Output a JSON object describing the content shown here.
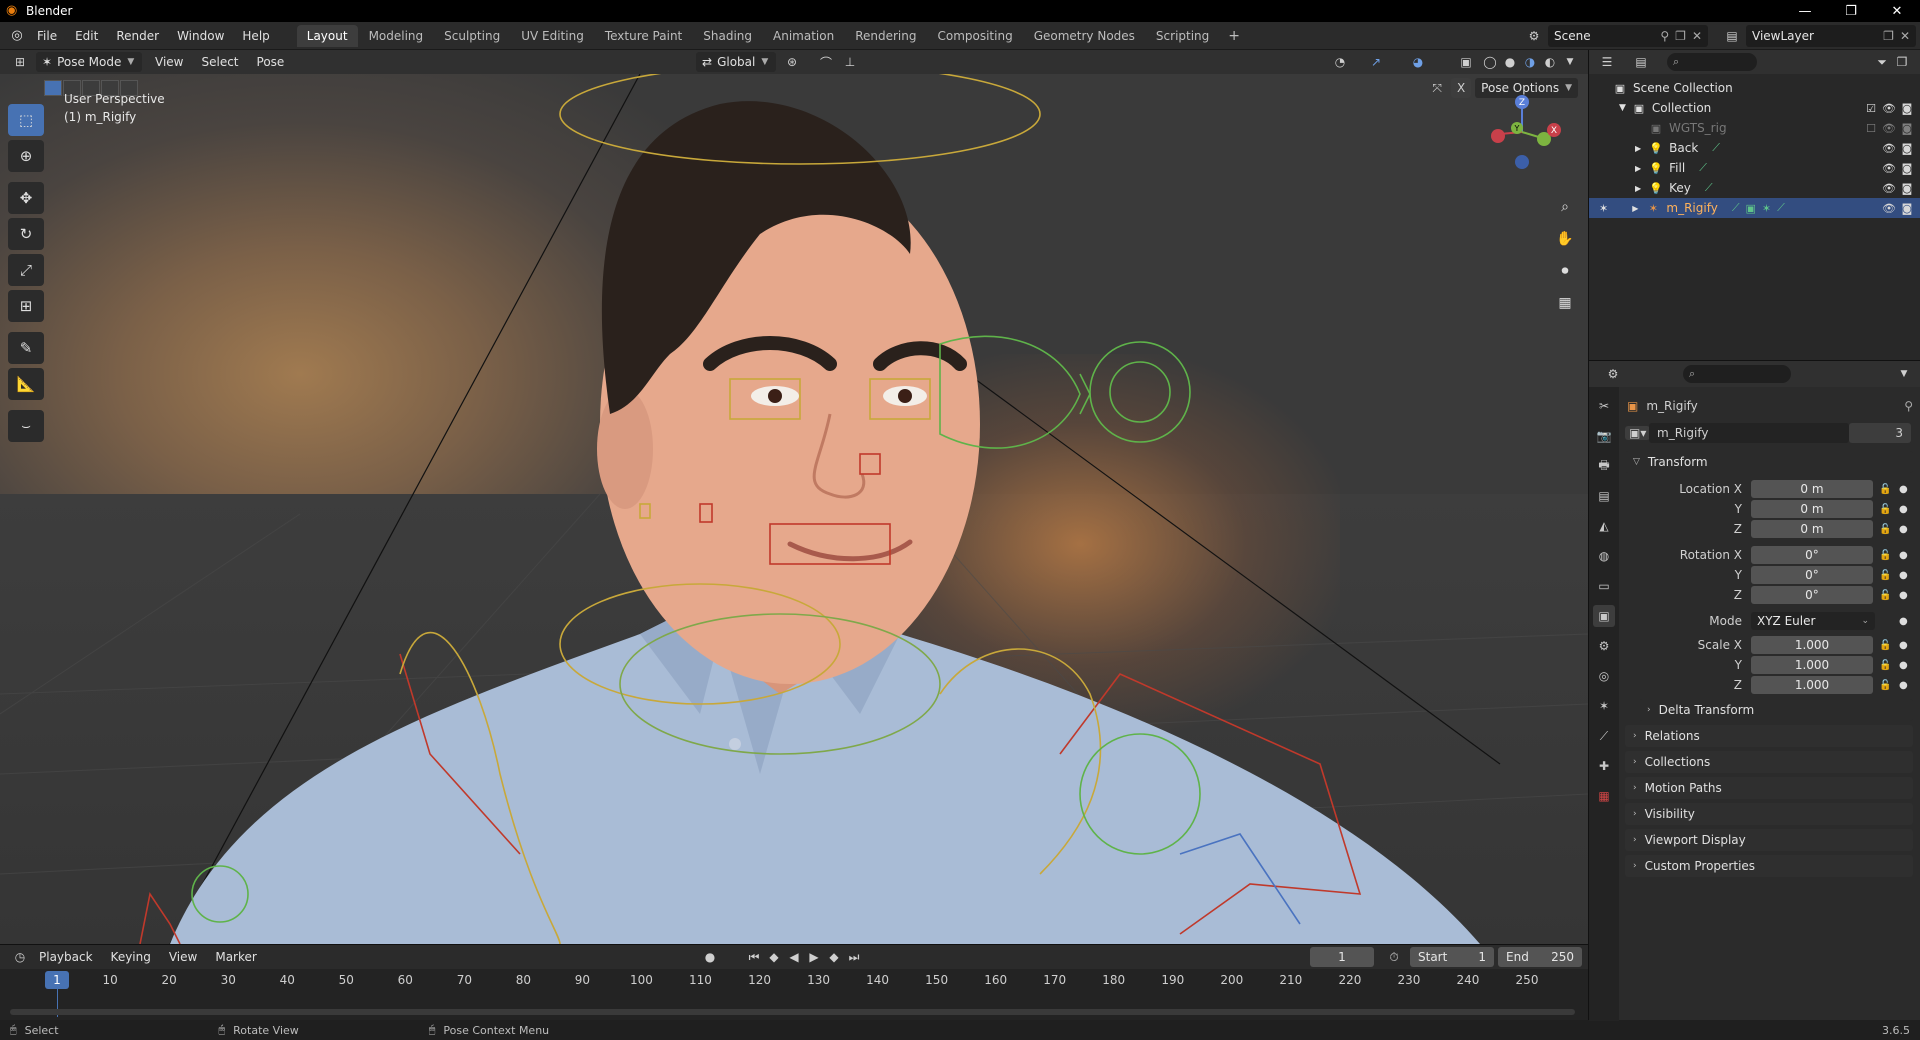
{
  "window": {
    "title": "Blender",
    "buttons": [
      "—",
      "❐",
      "✕"
    ]
  },
  "menu": [
    "File",
    "Edit",
    "Render",
    "Window",
    "Help"
  ],
  "workspaces": {
    "active": "Layout",
    "tabs": [
      "Layout",
      "Modeling",
      "Sculpting",
      "UV Editing",
      "Texture Paint",
      "Shading",
      "Animation",
      "Rendering",
      "Compositing",
      "Geometry Nodes",
      "Scripting"
    ]
  },
  "scene": {
    "name": "Scene",
    "view_layer": "ViewLayer"
  },
  "viewport_header": {
    "mode": "Pose Mode",
    "menus": [
      "View",
      "Select",
      "Pose"
    ],
    "orientation": "Global",
    "pose_options": "Pose Options"
  },
  "viewport": {
    "perspective": "User Perspective",
    "active_object": "(1) m_Rigify",
    "gizmo": {
      "z": "Z",
      "y": "Y",
      "x": "X"
    }
  },
  "outliner": {
    "root": "Scene Collection",
    "collection": "Collection",
    "items": [
      {
        "name": "WGTS_rig",
        "dim": true
      },
      {
        "name": "Back"
      },
      {
        "name": "Fill"
      },
      {
        "name": "Key"
      },
      {
        "name": "m_Rigify",
        "selected": true
      }
    ]
  },
  "properties": {
    "object_name": "m_Rigify",
    "data_name": "m_Rigify",
    "users": "3",
    "transform": {
      "header": "Transform",
      "location": {
        "label": "Location X",
        "x": "0 m",
        "y": "0 m",
        "z": "0 m"
      },
      "rotation": {
        "label": "Rotation X",
        "x": "0°",
        "y": "0°",
        "z": "0°"
      },
      "mode_label": "Mode",
      "mode": "XYZ Euler",
      "scale": {
        "label": "Scale X",
        "x": "1.000",
        "y": "1.000",
        "z": "1.000"
      },
      "axis_y": "Y",
      "axis_z": "Z"
    },
    "subpanels": [
      "Delta Transform"
    ],
    "panels": [
      "Relations",
      "Collections",
      "Motion Paths",
      "Visibility",
      "Viewport Display",
      "Custom Properties"
    ]
  },
  "timeline": {
    "menus": [
      "Playback",
      "Keying",
      "View",
      "Marker"
    ],
    "current_frame": "1",
    "start_label": "Start",
    "start": "1",
    "end_label": "End",
    "end": "250",
    "ruler": [
      "1",
      "10",
      "20",
      "30",
      "40",
      "50",
      "60",
      "70",
      "80",
      "90",
      "100",
      "110",
      "120",
      "130",
      "140",
      "150",
      "160",
      "170",
      "180",
      "190",
      "200",
      "210",
      "220",
      "230",
      "240",
      "250"
    ]
  },
  "statusbar": {
    "select": "Select",
    "rotate": "Rotate View",
    "context": "Pose Context Menu",
    "version": "3.6.5"
  }
}
